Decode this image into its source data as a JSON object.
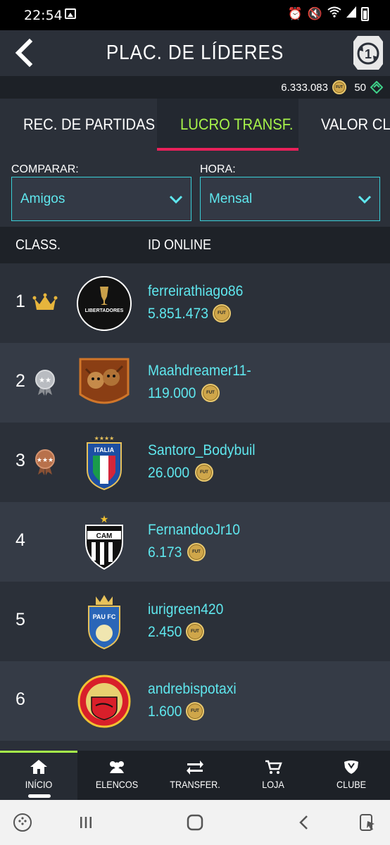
{
  "status": {
    "time": "22:54"
  },
  "header": {
    "title": "PLAC. DE LÍDERES",
    "season_number": "1"
  },
  "currency": {
    "coins": "6.333.083",
    "coin_label": "FUT",
    "points": "50"
  },
  "tabs": [
    {
      "label": "REC. DE PARTIDAS"
    },
    {
      "label": "LUCRO TRANSF."
    },
    {
      "label": "VALOR CLUBE"
    }
  ],
  "filters": {
    "compare_label": "COMPARAR:",
    "compare_value": "Amigos",
    "time_label": "HORA:",
    "time_value": "Mensal"
  },
  "table": {
    "col_rank": "CLASS.",
    "col_id": "ID ONLINE",
    "rows": [
      {
        "rank": "1",
        "rank_icon": "crown-icon",
        "name": "ferreirathiago86",
        "amount": "5.851.473",
        "badge": "libertadores-badge"
      },
      {
        "rank": "2",
        "rank_icon": "silver-medal-icon",
        "name": "Maahdreamer11-",
        "amount": "119.000",
        "badge": "custom-crest-badge"
      },
      {
        "rank": "3",
        "rank_icon": "bronze-medal-icon",
        "name": "Santoro_Bodybuil",
        "amount": "26.000",
        "badge": "italia-badge"
      },
      {
        "rank": "4",
        "rank_icon": "",
        "name": "FernandooJr10",
        "amount": "6.173",
        "badge": "atletico-mineiro-badge"
      },
      {
        "rank": "5",
        "rank_icon": "",
        "name": "iurigreen420",
        "amount": "2.450",
        "badge": "pau-fc-badge"
      },
      {
        "rank": "6",
        "rank_icon": "",
        "name": "andrebispotaxi",
        "amount": "1.600",
        "badge": "manchester-united-badge"
      }
    ]
  },
  "coin_text": "FUT",
  "badge_text": {
    "libertadores": "LIBERTADORES",
    "italia": "ITALIA",
    "cam": "CAM",
    "pau": "PAU FC"
  },
  "bottom_nav": [
    {
      "label": "INÍCIO",
      "icon": "home-icon"
    },
    {
      "label": "ELENCOS",
      "icon": "squads-icon"
    },
    {
      "label": "TRANSFER.",
      "icon": "transfer-arrows-icon"
    },
    {
      "label": "LOJA",
      "icon": "cart-icon"
    },
    {
      "label": "CLUBE",
      "icon": "club-icon"
    }
  ],
  "colors": {
    "accent_green": "#a6f34a",
    "accent_cyan": "#5fe7ee",
    "tab_underline": "#e8215a",
    "select_border": "#39d0d8"
  }
}
